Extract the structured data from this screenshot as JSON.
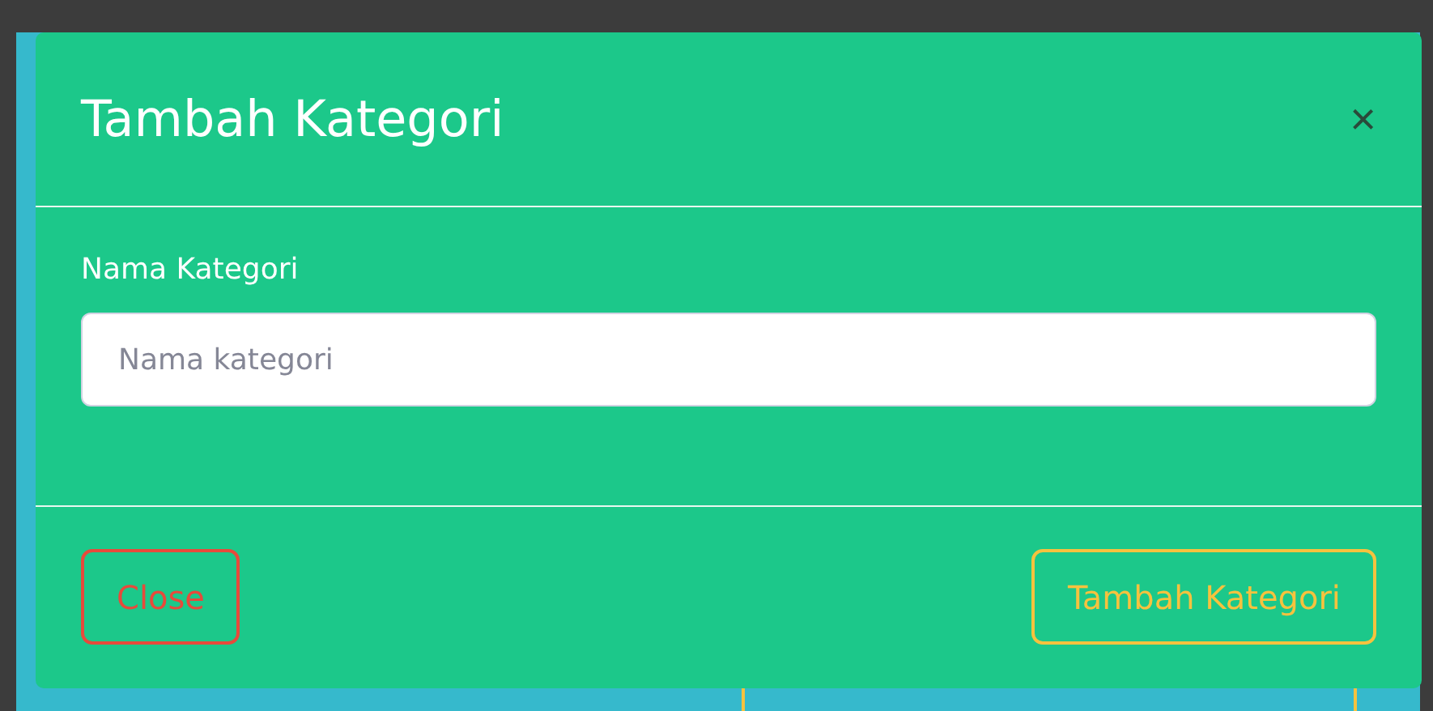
{
  "modal": {
    "title": "Tambah Kategori",
    "close_icon": "×",
    "field": {
      "label": "Nama Kategori",
      "placeholder": "Nama kategori"
    },
    "buttons": [
      {
        "label": "Close",
        "kind": "danger"
      },
      {
        "label": "Tambah Kategori",
        "kind": "warning"
      }
    ]
  }
}
